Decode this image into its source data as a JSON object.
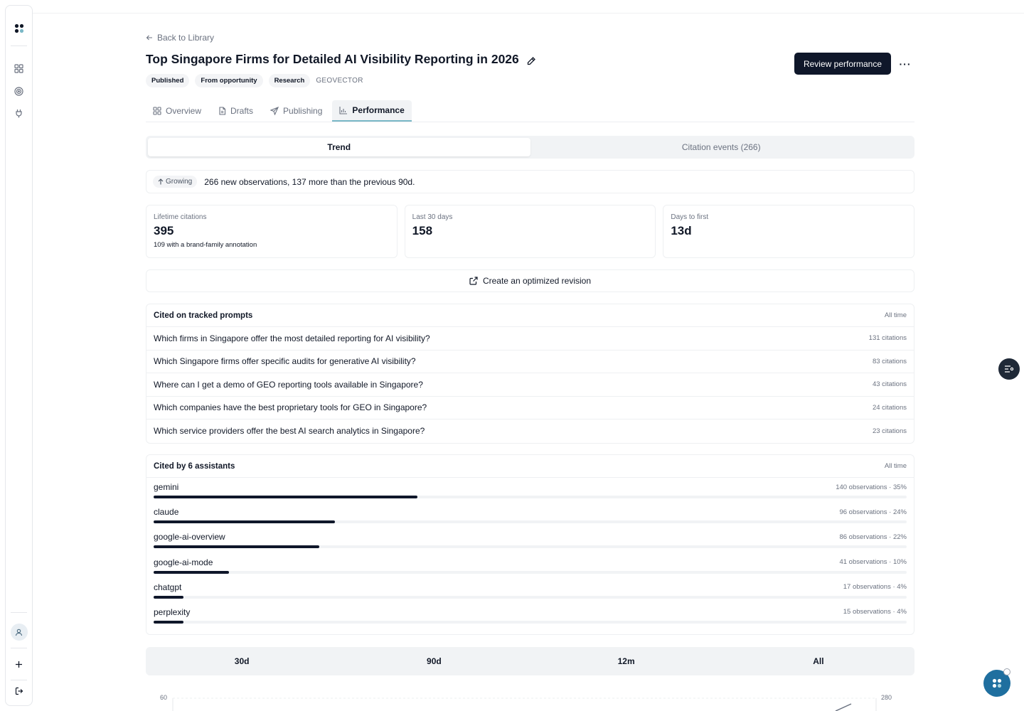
{
  "sidebar": {
    "icons": [
      "app-logo-icon",
      "grid-icon",
      "target-icon",
      "plug-icon",
      "user-icon",
      "plus-icon",
      "logout-icon"
    ]
  },
  "header": {
    "back_label": "Back to Library",
    "title": "Top Singapore Firms for Detailed AI Visibility Reporting in 2026",
    "tags": [
      "Published",
      "From opportunity",
      "Research"
    ],
    "brand": "GEOVECTOR",
    "primary_action": "Review performance"
  },
  "tabs": [
    {
      "label": "Overview",
      "icon": "grid-icon"
    },
    {
      "label": "Drafts",
      "icon": "document-icon"
    },
    {
      "label": "Publishing",
      "icon": "send-icon"
    },
    {
      "label": "Performance",
      "icon": "bar-chart-icon",
      "active": true
    }
  ],
  "segmented": {
    "trend": "Trend",
    "citation_events": "Citation events (266)",
    "active": "trend"
  },
  "growth": {
    "badge": "Growing",
    "text": "266 new observations, 137 more than the previous 90d."
  },
  "stats": [
    {
      "label": "Lifetime citations",
      "value": "395",
      "sub": "109 with a brand-family annotation"
    },
    {
      "label": "Last 30 days",
      "value": "158",
      "sub": ""
    },
    {
      "label": "Days to first",
      "value": "13d",
      "sub": ""
    }
  ],
  "optimize_label": "Create an optimized revision",
  "prompts": {
    "title": "Cited on tracked prompts",
    "meta": "All time",
    "rows": [
      {
        "text": "Which firms in Singapore offer the most detailed reporting for AI visibility?",
        "count": "131 citations"
      },
      {
        "text": "Which Singapore firms offer specific audits for generative AI visibility?",
        "count": "83 citations"
      },
      {
        "text": "Where can I get a demo of GEO reporting tools available in Singapore?",
        "count": "43 citations"
      },
      {
        "text": "Which companies have the best proprietary tools for GEO in Singapore?",
        "count": "24 citations"
      },
      {
        "text": "Which service providers offer the best AI search analytics in Singapore?",
        "count": "23 citations"
      }
    ]
  },
  "assistants": {
    "title": "Cited by 6 assistants",
    "meta": "All time",
    "rows": [
      {
        "name": "gemini",
        "meta": "140 observations · 35%",
        "share": 0.35
      },
      {
        "name": "claude",
        "meta": "96 observations · 24%",
        "share": 0.24
      },
      {
        "name": "google-ai-overview",
        "meta": "86 observations · 22%",
        "share": 0.22
      },
      {
        "name": "google-ai-mode",
        "meta": "41 observations · 10%",
        "share": 0.1
      },
      {
        "name": "chatgpt",
        "meta": "17 observations · 4%",
        "share": 0.04
      },
      {
        "name": "perplexity",
        "meta": "15 observations · 4%",
        "share": 0.04
      }
    ]
  },
  "range": [
    "30d",
    "90d",
    "12m",
    "All"
  ],
  "chart": {
    "y_left_top": "60",
    "y_right_top": "280"
  }
}
